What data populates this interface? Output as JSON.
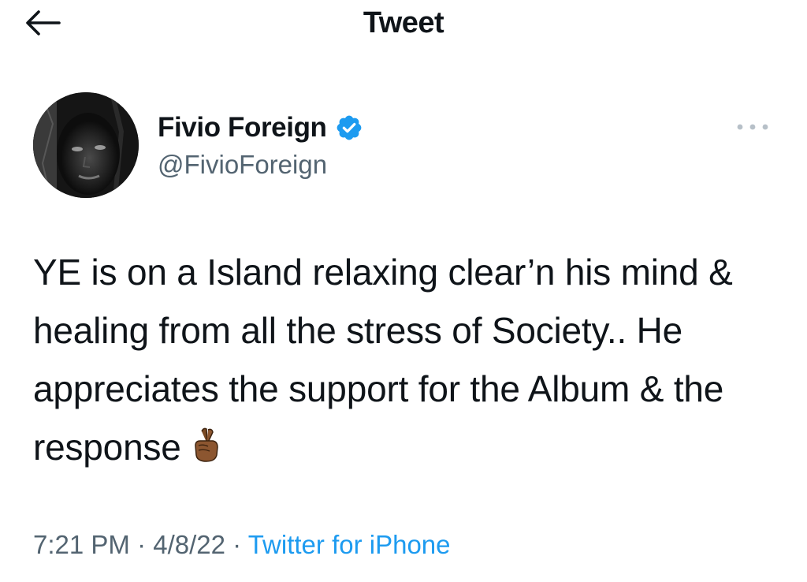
{
  "header": {
    "title": "Tweet",
    "back_icon": "arrow-left-icon"
  },
  "author": {
    "display_name": "Fivio Foreign",
    "handle": "@FivioForeign",
    "verified": true,
    "verified_icon": "verified-badge-icon",
    "more_icon": "more-horizontal-icon"
  },
  "tweet": {
    "text": "YE is on a Island relaxing clear’n his mind & healing from all the stress of Society.. He appreciates the support for the Album & the response",
    "emoji": "crossed-fingers-icon"
  },
  "meta": {
    "time": "7:21 PM",
    "separator_1": " · ",
    "date": "4/8/22",
    "separator_2": " · ",
    "source": "Twitter for iPhone"
  },
  "colors": {
    "text": "#0f1419",
    "secondary": "#536471",
    "accent": "#1d9bf0"
  }
}
